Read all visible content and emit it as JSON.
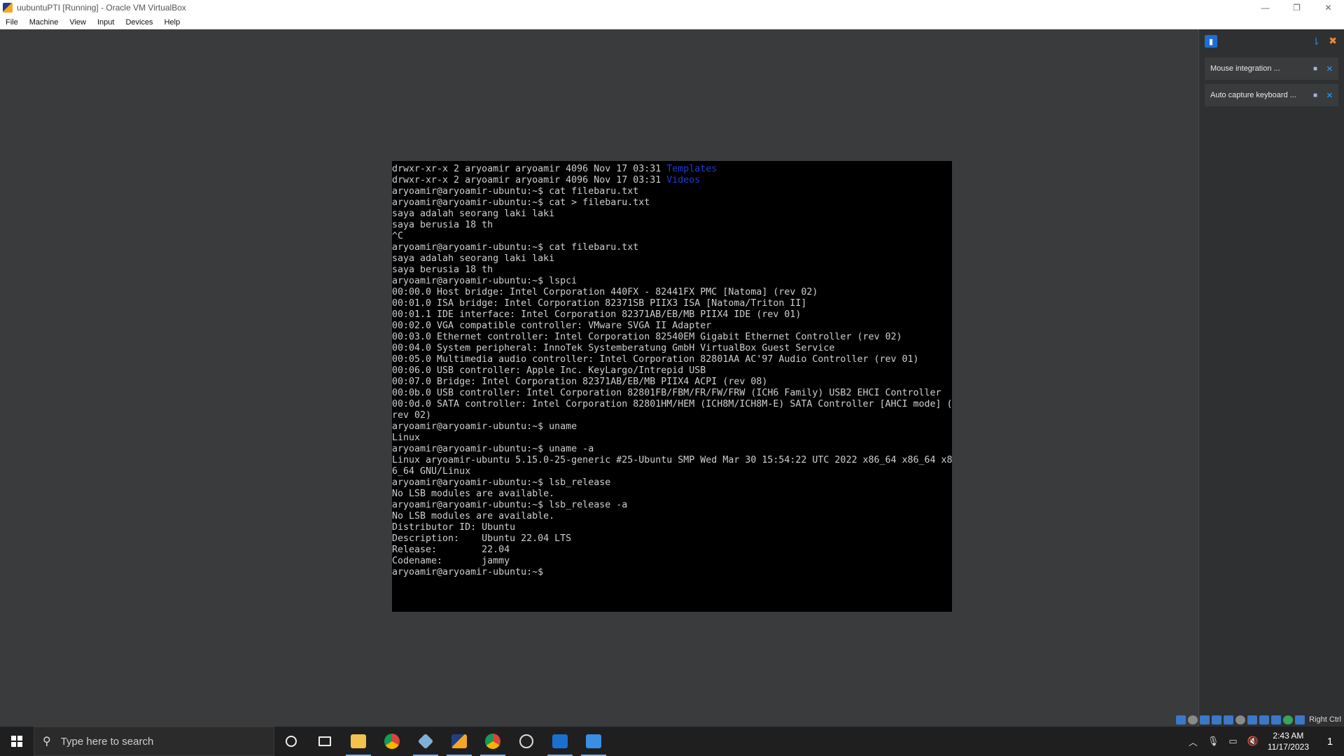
{
  "window": {
    "title": "uubuntuPTI [Running] - Oracle VM VirtualBox",
    "controls": [
      "—",
      "❐",
      "✕"
    ]
  },
  "menu": [
    "File",
    "Machine",
    "View",
    "Input",
    "Devices",
    "Help"
  ],
  "terminal": {
    "lines": [
      {
        "text": "drwxr-xr-x 2 aryoamir aryoamir 4096 Nov 17 03:31 ",
        "dir": "Templates"
      },
      {
        "text": "drwxr-xr-x 2 aryoamir aryoamir 4096 Nov 17 03:31 ",
        "dir": "Videos"
      },
      {
        "text": "aryoamir@aryoamir-ubuntu:~$ cat filebaru.txt"
      },
      {
        "text": "aryoamir@aryoamir-ubuntu:~$ cat > filebaru.txt"
      },
      {
        "text": "saya adalah seorang laki laki"
      },
      {
        "text": "saya berusia 18 th"
      },
      {
        "text": "^C"
      },
      {
        "text": "aryoamir@aryoamir-ubuntu:~$ cat filebaru.txt"
      },
      {
        "text": "saya adalah seorang laki laki"
      },
      {
        "text": "saya berusia 18 th"
      },
      {
        "text": "aryoamir@aryoamir-ubuntu:~$ lspci"
      },
      {
        "text": "00:00.0 Host bridge: Intel Corporation 440FX - 82441FX PMC [Natoma] (rev 02)"
      },
      {
        "text": "00:01.0 ISA bridge: Intel Corporation 82371SB PIIX3 ISA [Natoma/Triton II]"
      },
      {
        "text": "00:01.1 IDE interface: Intel Corporation 82371AB/EB/MB PIIX4 IDE (rev 01)"
      },
      {
        "text": "00:02.0 VGA compatible controller: VMware SVGA II Adapter"
      },
      {
        "text": "00:03.0 Ethernet controller: Intel Corporation 82540EM Gigabit Ethernet Controller (rev 02)"
      },
      {
        "text": "00:04.0 System peripheral: InnoTek Systemberatung GmbH VirtualBox Guest Service"
      },
      {
        "text": "00:05.0 Multimedia audio controller: Intel Corporation 82801AA AC'97 Audio Controller (rev 01)"
      },
      {
        "text": "00:06.0 USB controller: Apple Inc. KeyLargo/Intrepid USB"
      },
      {
        "text": "00:07.0 Bridge: Intel Corporation 82371AB/EB/MB PIIX4 ACPI (rev 08)"
      },
      {
        "text": "00:0b.0 USB controller: Intel Corporation 82801FB/FBM/FR/FW/FRW (ICH6 Family) USB2 EHCI Controller"
      },
      {
        "text": "00:0d.0 SATA controller: Intel Corporation 82801HM/HEM (ICH8M/ICH8M-E) SATA Controller [AHCI mode] ("
      },
      {
        "text": "rev 02)"
      },
      {
        "text": "aryoamir@aryoamir-ubuntu:~$ uname"
      },
      {
        "text": "Linux"
      },
      {
        "text": "aryoamir@aryoamir-ubuntu:~$ uname -a"
      },
      {
        "text": "Linux aryoamir-ubuntu 5.15.0-25-generic #25-Ubuntu SMP Wed Mar 30 15:54:22 UTC 2022 x86_64 x86_64 x8"
      },
      {
        "text": "6_64 GNU/Linux"
      },
      {
        "text": "aryoamir@aryoamir-ubuntu:~$ lsb_release"
      },
      {
        "text": "No LSB modules are available."
      },
      {
        "text": "aryoamir@aryoamir-ubuntu:~$ lsb_release -a"
      },
      {
        "text": "No LSB modules are available."
      },
      {
        "text": "Distributor ID: Ubuntu"
      },
      {
        "text": "Description:    Ubuntu 22.04 LTS"
      },
      {
        "text": "Release:        22.04"
      },
      {
        "text": "Codename:       jammy"
      },
      {
        "text": "aryoamir@aryoamir-ubuntu:~$"
      }
    ]
  },
  "notifications": {
    "items": [
      {
        "label": "Mouse integration ..."
      },
      {
        "label": "Auto capture keyboard ..."
      }
    ]
  },
  "statusbar": {
    "host_key": "Right Ctrl"
  },
  "taskbar": {
    "search_placeholder": "Type here to search",
    "clock_time": "2:43 AM",
    "clock_date": "11/17/2023",
    "notification_count": "1"
  },
  "colors": {
    "terminal_bg": "#000000",
    "terminal_fg": "#cfcfcf",
    "directory": "#1f3bd6",
    "vm_background": "#3a3b3d",
    "accent": "#2d8be6"
  }
}
